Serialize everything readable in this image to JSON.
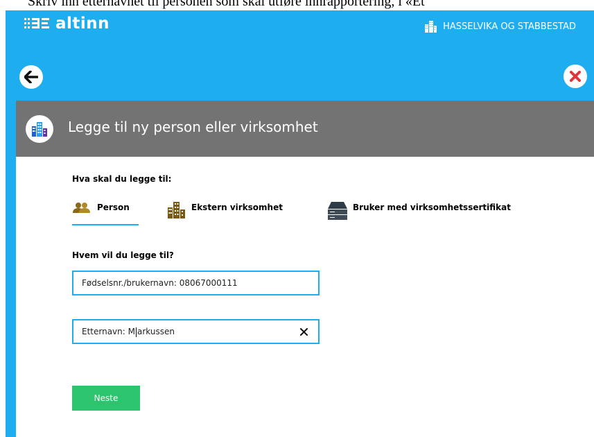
{
  "instruction_text": "Skriv inn etternavnet til personen som skal utføre innrapportering, i «Et",
  "header": {
    "brand": "altinn",
    "org_name": "HASSELVIKA OG STABBESTAD",
    "logo_icon": "altinn-logo-icon",
    "org_icon": "buildings-icon"
  },
  "nav": {
    "back_icon": "arrow-left-icon",
    "close_icon": "close-icon"
  },
  "card": {
    "title": "Legge til ny person eller virksomhet",
    "header_icon": "buildings-icon",
    "what_label": "Hva skal du legge til:",
    "types": [
      {
        "label": "Person",
        "icon": "people-icon",
        "active": true
      },
      {
        "label": "Ekstern virksomhet",
        "icon": "buildings-icon",
        "active": false
      },
      {
        "label": "Bruker med virksomhetssertifikat",
        "icon": "server-icon",
        "active": false
      }
    ],
    "who_label": "Hvem vil du legge til?",
    "fields": {
      "fnr": {
        "prefix": "Fødselsnr./brukernavn: ",
        "value": "08067000111"
      },
      "etternavn": {
        "prefix": "Etternavn: ",
        "value_before_caret": "M",
        "value_after_caret": "arkussen"
      }
    },
    "next_label": "Neste"
  },
  "colors": {
    "brand_blue": "#1eaef0",
    "header_gray": "#737373",
    "next_green": "#2cc46c",
    "close_red": "#e0353b"
  }
}
